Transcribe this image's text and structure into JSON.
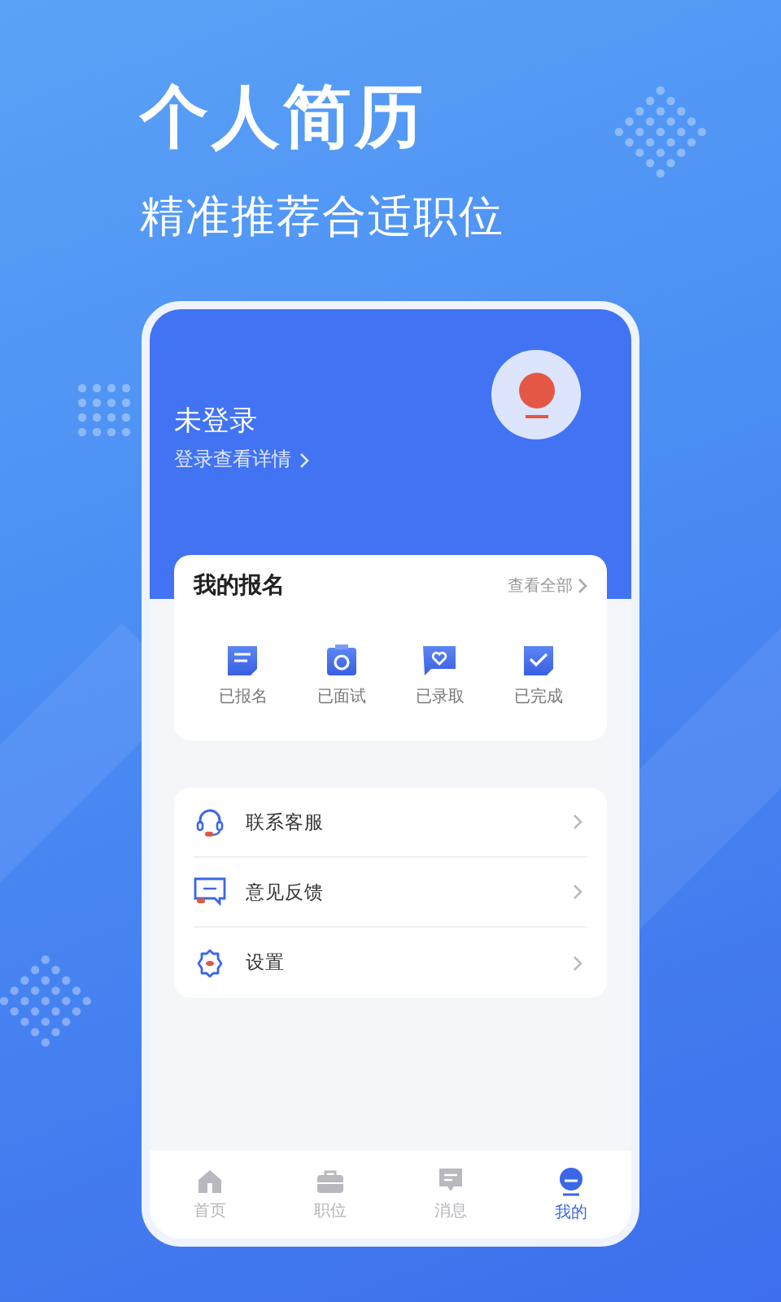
{
  "headline": {
    "title": "个人简历",
    "subtitle": "精准推荐合适职位"
  },
  "profile": {
    "name": "未登录",
    "link": "登录查看详情"
  },
  "signup": {
    "title": "我的报名",
    "more": "查看全部",
    "items": [
      {
        "label": "已报名",
        "kind": "signed"
      },
      {
        "label": "已面试",
        "kind": "interview"
      },
      {
        "label": "已录取",
        "kind": "hired"
      },
      {
        "label": "已完成",
        "kind": "done"
      }
    ]
  },
  "menu": [
    {
      "label": "联系客服",
      "kind": "service"
    },
    {
      "label": "意见反馈",
      "kind": "feedback"
    },
    {
      "label": "设置",
      "kind": "settings"
    }
  ],
  "tabs": [
    {
      "label": "首页",
      "kind": "home",
      "selected": false
    },
    {
      "label": "职位",
      "kind": "jobs",
      "selected": false
    },
    {
      "label": "消息",
      "kind": "messages",
      "selected": false
    },
    {
      "label": "我的",
      "kind": "me",
      "selected": true
    }
  ]
}
